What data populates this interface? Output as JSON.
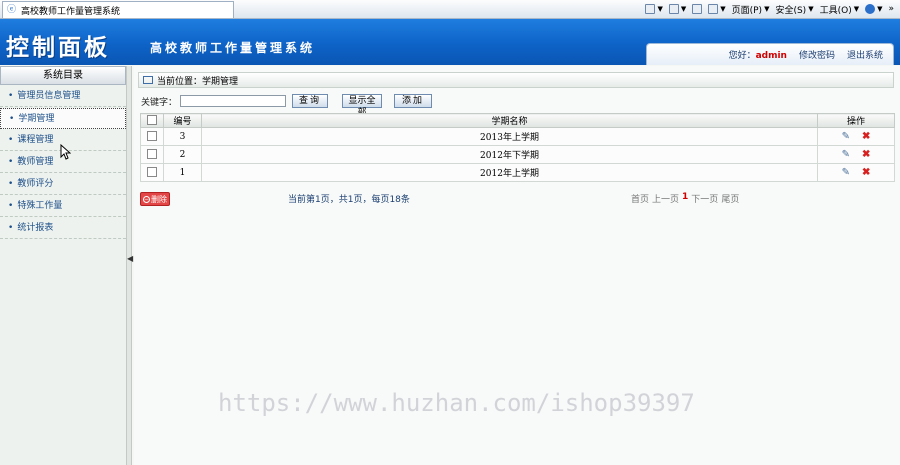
{
  "browser": {
    "tab_title": "高校教师工作量管理系统",
    "tools": [
      "页面(P)",
      "安全(S)",
      "工具(O)"
    ]
  },
  "header": {
    "title": "控制面板",
    "subtitle": "高校教师工作量管理系统",
    "greeting": "您好：",
    "username": "admin",
    "change_password": "修改密码",
    "logout": "退出系统"
  },
  "sidebar": {
    "title": "系统目录",
    "items": [
      {
        "label": "管理员信息管理"
      },
      {
        "label": "学期管理"
      },
      {
        "label": "课程管理"
      },
      {
        "label": "教师管理"
      },
      {
        "label": "教师评分"
      },
      {
        "label": "特殊工作量"
      },
      {
        "label": "统计报表"
      }
    ],
    "active_index": 1
  },
  "main": {
    "location": "当前位置：学期管理",
    "search": {
      "label": "关键字：",
      "value": "",
      "search_btn": "查询",
      "show_all_btn": "显示全部",
      "add_btn": "添加"
    },
    "table": {
      "headers": [
        "编号",
        "学期名称",
        "操作"
      ],
      "rows": [
        {
          "id": "3",
          "name": "2013年上学期"
        },
        {
          "id": "2",
          "name": "2012年下学期"
        },
        {
          "id": "1",
          "name": "2012年上学期"
        }
      ]
    },
    "delete_btn": "删除",
    "page_info": "当前第1页，共1页，每页18条",
    "pager": {
      "first": "首页",
      "prev": "上一页",
      "current": "1",
      "next": "下一页",
      "last": "尾页"
    }
  },
  "watermark": "https://www.huzhan.com/ishop39397",
  "colors": {
    "header_blue": "#0e63c7",
    "admin_red": "#d10000",
    "delete_red": "#d72020"
  }
}
